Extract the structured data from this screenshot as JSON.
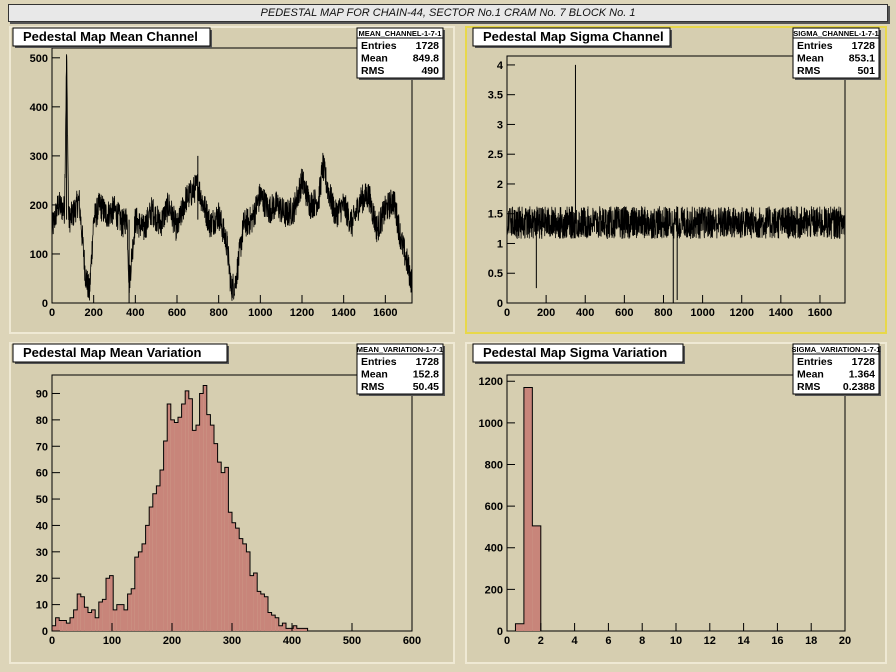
{
  "window_title": "PEDESTAL MAP FOR CHAIN-44, SECTOR No.1 CRAM No. 7 BLOCK No. 1",
  "colors": {
    "frame": "#d6ceb0",
    "fill_hist": "#c8857a",
    "line": "#000000",
    "selected_border": "#e8d84a"
  },
  "chart_data": [
    {
      "type": "line",
      "title": "Pedestal Map Mean Channel",
      "stats": {
        "name": "MEAN_CHANNEL-1-7-1",
        "entries_label": "Entries",
        "entries": "1728",
        "mean_label": "Mean",
        "mean": "849.8",
        "rms_label": "RMS",
        "rms": "490"
      },
      "xlim": [
        0,
        1728
      ],
      "ylim": [
        0,
        520
      ],
      "xticks": [
        0,
        200,
        400,
        600,
        800,
        1000,
        1200,
        1400,
        1600
      ],
      "yticks": [
        0,
        100,
        200,
        300,
        400,
        500
      ],
      "x": [
        0,
        30,
        60,
        70,
        80,
        100,
        130,
        160,
        180,
        200,
        230,
        260,
        300,
        340,
        360,
        370,
        400,
        440,
        480,
        520,
        560,
        600,
        640,
        680,
        700,
        720,
        760,
        800,
        840,
        860,
        880,
        920,
        960,
        1000,
        1040,
        1080,
        1120,
        1160,
        1200,
        1240,
        1280,
        1300,
        1320,
        1360,
        1400,
        1440,
        1480,
        1520,
        1560,
        1600,
        1640,
        1680,
        1700,
        1728
      ],
      "y": [
        150,
        200,
        190,
        505,
        170,
        180,
        210,
        60,
        20,
        170,
        200,
        180,
        190,
        160,
        175,
        40,
        170,
        150,
        190,
        160,
        200,
        150,
        210,
        230,
        240,
        210,
        160,
        180,
        120,
        30,
        40,
        160,
        170,
        220,
        190,
        200,
        180,
        190,
        250,
        200,
        210,
        280,
        240,
        180,
        200,
        160,
        210,
        220,
        150,
        190,
        210,
        120,
        90,
        40
      ],
      "spikes": [
        {
          "x": 70,
          "y": 505
        },
        {
          "x": 370,
          "y": 0
        },
        {
          "x": 700,
          "y": 300
        }
      ]
    },
    {
      "type": "line",
      "title": "Pedestal Map Sigma Channel",
      "stats": {
        "name": "SIGMA_CHANNEL-1-7-1",
        "entries_label": "Entries",
        "entries": "1728",
        "mean_label": "Mean",
        "mean": "853.1",
        "rms_label": "RMS",
        "rms": "501"
      },
      "xlim": [
        0,
        1728
      ],
      "ylim": [
        0,
        4.15
      ],
      "xticks": [
        0,
        200,
        400,
        600,
        800,
        1000,
        1200,
        1400,
        1600
      ],
      "yticks": [
        0,
        0.5,
        1,
        1.5,
        2,
        2.5,
        3,
        3.5,
        4
      ],
      "baseline": 1.35,
      "spikes": [
        {
          "x": 150,
          "y": 0.25
        },
        {
          "x": 350,
          "y": 4.0
        },
        {
          "x": 850,
          "y": 0.0
        },
        {
          "x": 870,
          "y": 0.05
        }
      ]
    },
    {
      "type": "bar",
      "title": "Pedestal Map Mean Variation",
      "stats": {
        "name": "MEAN_VARIATION-1-7-1",
        "entries_label": "Entries",
        "entries": "1728",
        "mean_label": "Mean",
        "mean": "152.8",
        "rms_label": "RMS",
        "rms": "50.45"
      },
      "xlim": [
        0,
        600
      ],
      "ylim": [
        0,
        97
      ],
      "xticks": [
        0,
        100,
        200,
        300,
        400,
        500,
        600
      ],
      "yticks": [
        0,
        10,
        20,
        30,
        40,
        50,
        60,
        70,
        80,
        90
      ],
      "bin_width": 6,
      "values": [
        2,
        5,
        4,
        4,
        3,
        5,
        8,
        14,
        13,
        9,
        7,
        8,
        5,
        11,
        12,
        20,
        21,
        8,
        10,
        10,
        8,
        14,
        16,
        28,
        30,
        33,
        40,
        47,
        52,
        55,
        61,
        72,
        86,
        80,
        79,
        81,
        86,
        91,
        88,
        76,
        78,
        90,
        93,
        82,
        78,
        71,
        64,
        60,
        62,
        45,
        41,
        39,
        35,
        33,
        30,
        21,
        22,
        15,
        14,
        13,
        7,
        6,
        5,
        2,
        3,
        1,
        1,
        2,
        1,
        1,
        1,
        0,
        0,
        0,
        0,
        0,
        0,
        0,
        0,
        0,
        0,
        0,
        0,
        0,
        0,
        0,
        0,
        0,
        0,
        0,
        0,
        0,
        0,
        0,
        0,
        0,
        0,
        0,
        0,
        0
      ]
    },
    {
      "type": "bar",
      "title": "Pedestal Map Sigma Variation",
      "stats": {
        "name": "SIGMA_VARIATION-1-7-1",
        "entries_label": "Entries",
        "entries": "1728",
        "mean_label": "Mean",
        "mean": "1.364",
        "rms_label": "RMS",
        "rms": "0.2388"
      },
      "xlim": [
        0,
        20
      ],
      "ylim": [
        0,
        1230
      ],
      "xticks": [
        0,
        2,
        4,
        6,
        8,
        10,
        12,
        14,
        16,
        18,
        20
      ],
      "yticks": [
        0,
        200,
        400,
        600,
        800,
        1000,
        1200
      ],
      "bin_width": 0.5,
      "values": [
        0,
        35,
        1170,
        505,
        0,
        0,
        0,
        0,
        0,
        0,
        0,
        0,
        0,
        0,
        0,
        0,
        0,
        0,
        0,
        0,
        0,
        0,
        0,
        0,
        0,
        0,
        0,
        0,
        0,
        0,
        0,
        0,
        0,
        0,
        0,
        0,
        0,
        0,
        0,
        0
      ]
    }
  ]
}
